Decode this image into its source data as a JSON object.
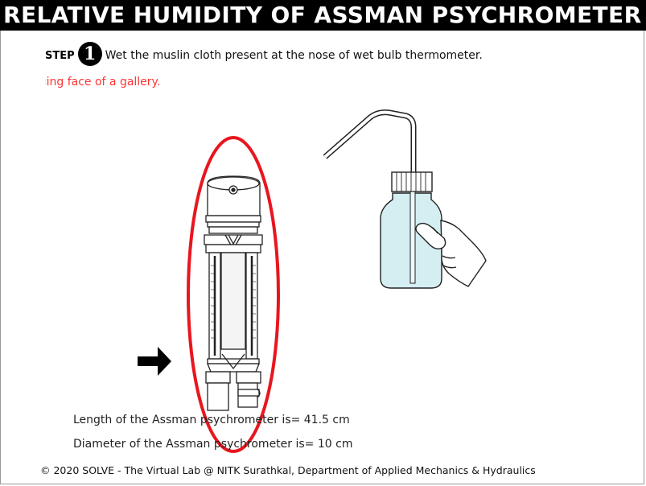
{
  "header": {
    "title": "RELATIVE HUMIDITY OF ASSMAN PSYCHROMETER"
  },
  "step": {
    "label": "STEP",
    "number": "1",
    "instruction": "Wet the muslin cloth present at the nose of wet bulb thermometer."
  },
  "marquee": {
    "text": "‹ing face of a gallery."
  },
  "illustration": {
    "highlight_color": "#e8161e",
    "bottle_tint": "#d4eef2",
    "icons": [
      "psychrometer-icon",
      "wash-bottle-icon",
      "hand-icon",
      "arrow-right-icon"
    ]
  },
  "measurements": {
    "length": "Length of the Assman psychrometer is= 41.5 cm",
    "diameter": "Diameter of the Assman psychrometer is= 10 cm"
  },
  "footer": {
    "text": "© 2020 SOLVE - The Virtual Lab @ NITK Surathkal, Department of Applied Mechanics & Hydraulics"
  }
}
